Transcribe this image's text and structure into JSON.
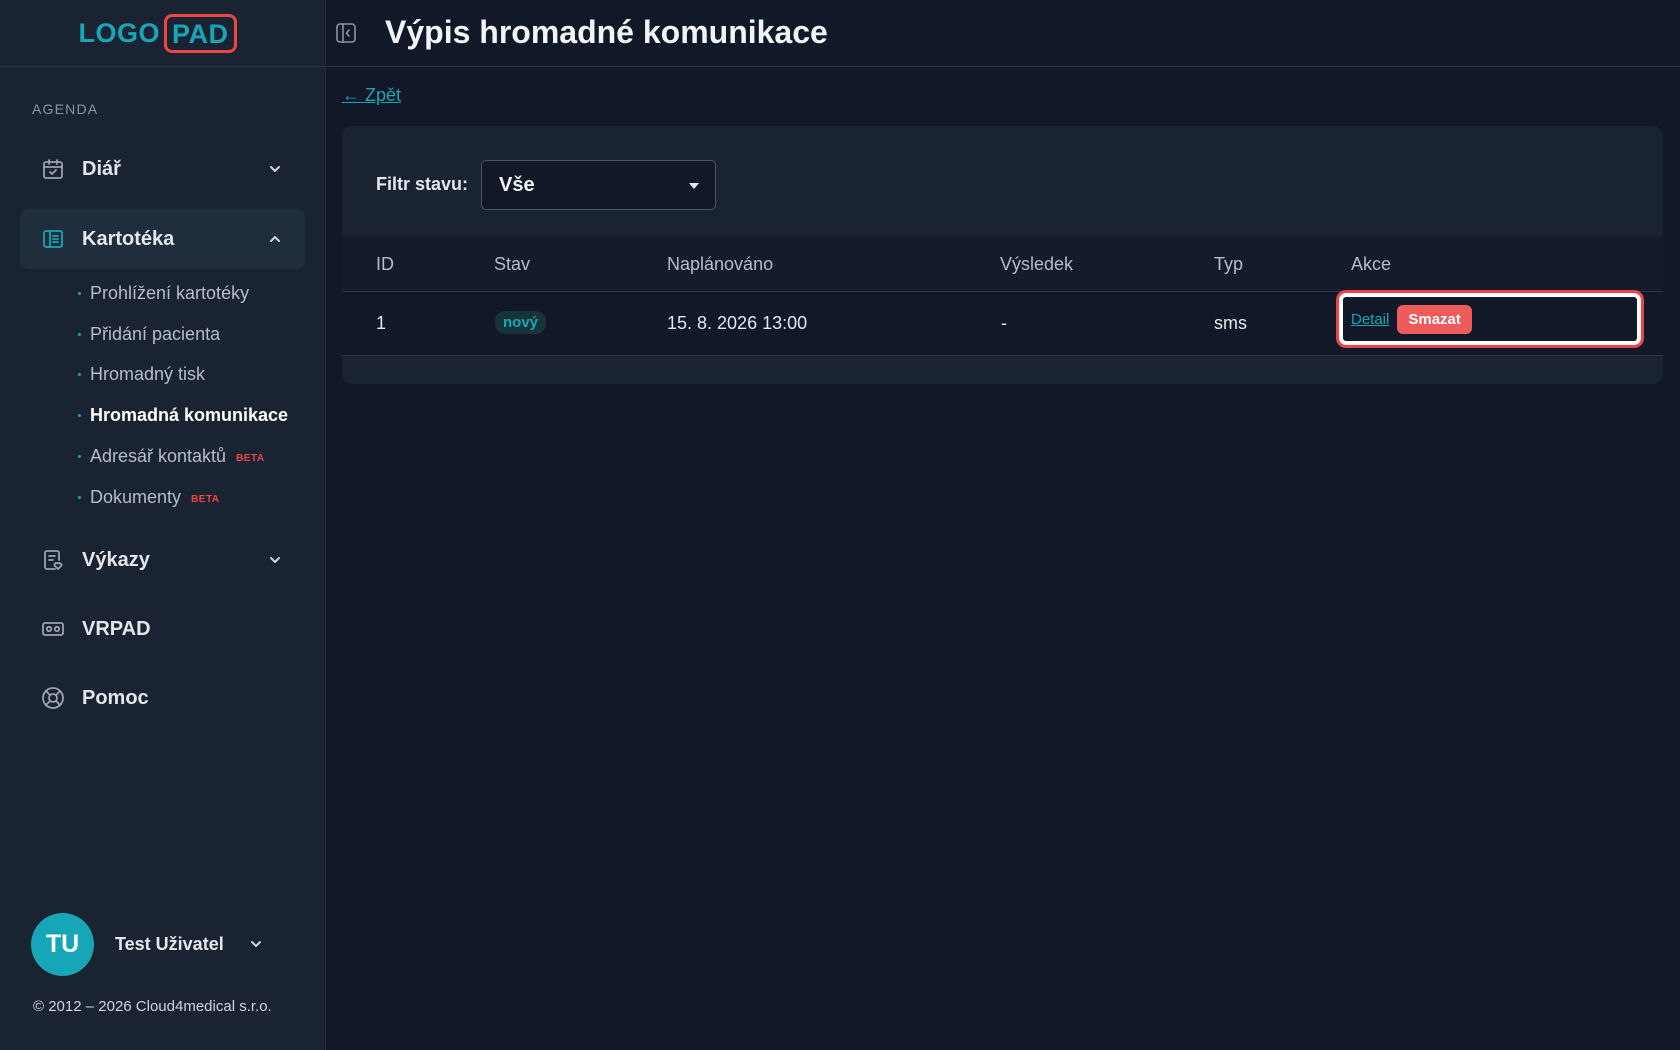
{
  "logo": {
    "part1": "LOGO",
    "part2": "PAD"
  },
  "sidebar": {
    "section_label": "AGENDA",
    "items": [
      {
        "label": "Diář",
        "icon": "calendar-check-icon",
        "expanded": false
      },
      {
        "label": "Kartotéka",
        "icon": "book-icon",
        "expanded": true
      },
      {
        "label": "Výkazy",
        "icon": "report-icon",
        "expanded": false
      },
      {
        "label": "VRPAD",
        "icon": "vr-headset-icon"
      },
      {
        "label": "Pomoc",
        "icon": "lifebuoy-icon"
      }
    ],
    "sub_items": [
      {
        "label": "Prohlížení kartotéky"
      },
      {
        "label": "Přidání pacienta"
      },
      {
        "label": "Hromadný tisk"
      },
      {
        "label": "Hromadná komunikace",
        "active": true
      },
      {
        "label": "Adresář kontaktů",
        "badge": "BETA"
      },
      {
        "label": "Dokumenty",
        "badge": "BETA"
      }
    ],
    "user": {
      "initials": "TU",
      "name": "Test Uživatel"
    },
    "copyright": "© 2012 – 2026 Cloud4medical s.r.o."
  },
  "header": {
    "title": "Výpis hromadné komunikace"
  },
  "main": {
    "back_link": "← Zpět",
    "filter": {
      "label": "Filtr stavu:",
      "value": "Vše"
    },
    "table": {
      "columns": [
        "ID",
        "Stav",
        "Naplánováno",
        "Výsledek",
        "Typ",
        "Akce"
      ],
      "rows": [
        {
          "id": "1",
          "status": "nový",
          "scheduled": "15. 8. 2026 13:00",
          "result": "-",
          "type": "sms",
          "detail": "Detail",
          "delete": "Smazat"
        }
      ]
    }
  },
  "colors": {
    "accent": "#17a6b8",
    "danger": "#ef4444",
    "background": "#111827",
    "sidebar": "#1a2332"
  }
}
